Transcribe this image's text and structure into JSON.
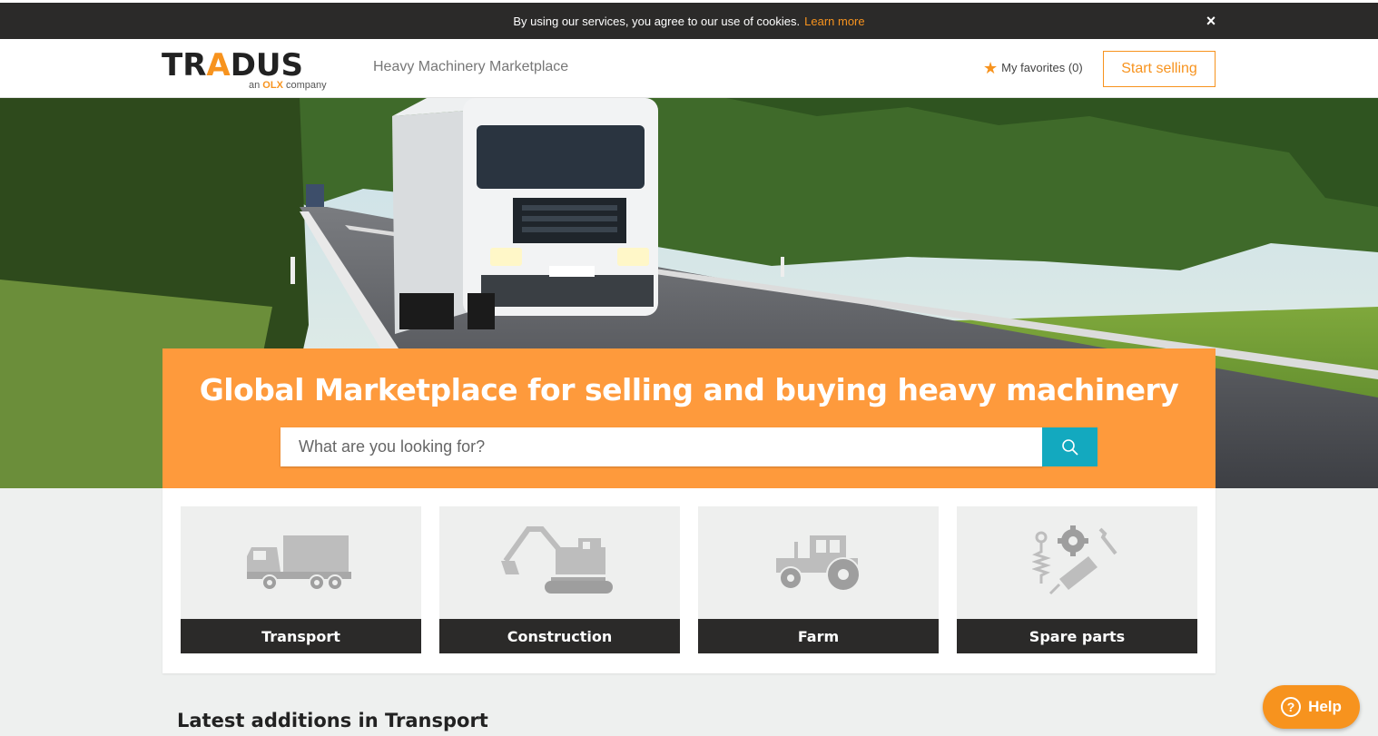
{
  "cookie_bar": {
    "message": "By using our services, you agree to our use of cookies.",
    "learn_more": "Learn more",
    "close_glyph": "×"
  },
  "header": {
    "logo_text_1": "TR",
    "logo_text_a": "A",
    "logo_text_2": "DUS",
    "logo_sub_prefix": "an ",
    "logo_sub_brand": "OLX",
    "logo_sub_suffix": " company",
    "tagline": "Heavy Machinery Marketplace",
    "favorites_label": "My favorites (0)",
    "start_selling": "Start selling"
  },
  "hero": {
    "title": "Global Marketplace for selling and buying heavy machinery",
    "search_placeholder": "What are you looking for?"
  },
  "categories": [
    {
      "label": "Transport",
      "icon": "truck-icon"
    },
    {
      "label": "Construction",
      "icon": "excavator-icon"
    },
    {
      "label": "Farm",
      "icon": "tractor-icon"
    },
    {
      "label": "Spare parts",
      "icon": "spare-parts-icon"
    }
  ],
  "latest_heading": "Latest additions in Transport",
  "help": {
    "label": "Help"
  },
  "colors": {
    "accent": "#f7931e",
    "search_panel": "#fe9a3c",
    "search_button": "#13a9bf",
    "dark": "#2b2a29"
  }
}
